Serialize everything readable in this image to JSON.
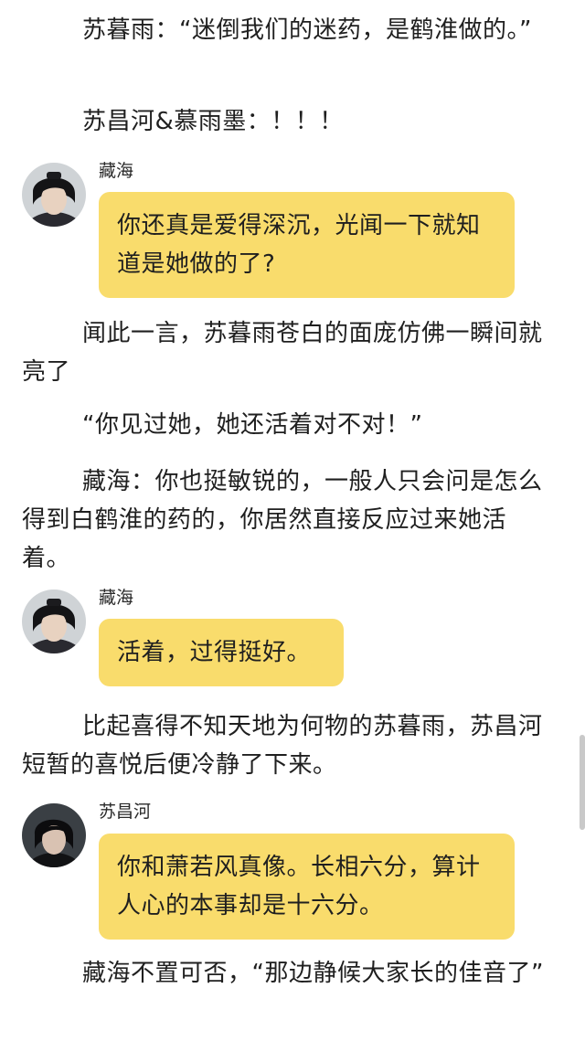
{
  "paragraphs": [
    "苏暮雨：“迷倒我们的迷药，是鹤淮做的。”",
    "苏昌河&慕雨墨：！！！",
    "闻此一言，苏暮雨苍白的面庞仿佛一瞬间就亮了",
    "“你见过她，她还活着对不对！”",
    "藏海：你也挺敏锐的，一般人只会问是怎么得到白鹤淮的药的，你居然直接反应过来她活着。",
    "比起喜得不知天地为何物的苏暮雨，苏昌河短暂的喜悦后便冷静了下来。",
    "藏海不置可否，“那边静候大家长的佳音了”"
  ],
  "messages": [
    {
      "speaker": "藏海",
      "text": "你还真是爱得深沉，光闻一下就知道是她做的了?"
    },
    {
      "speaker": "藏海",
      "text": "活着，过得挺好。"
    },
    {
      "speaker": "苏昌河",
      "text": "你和萧若风真像。长相六分，算计人心的本事却是十六分。"
    }
  ],
  "colors": {
    "bubble": "#f9dc6c",
    "text": "#1f1f1f",
    "scrollbar": "#c9c9c9"
  }
}
